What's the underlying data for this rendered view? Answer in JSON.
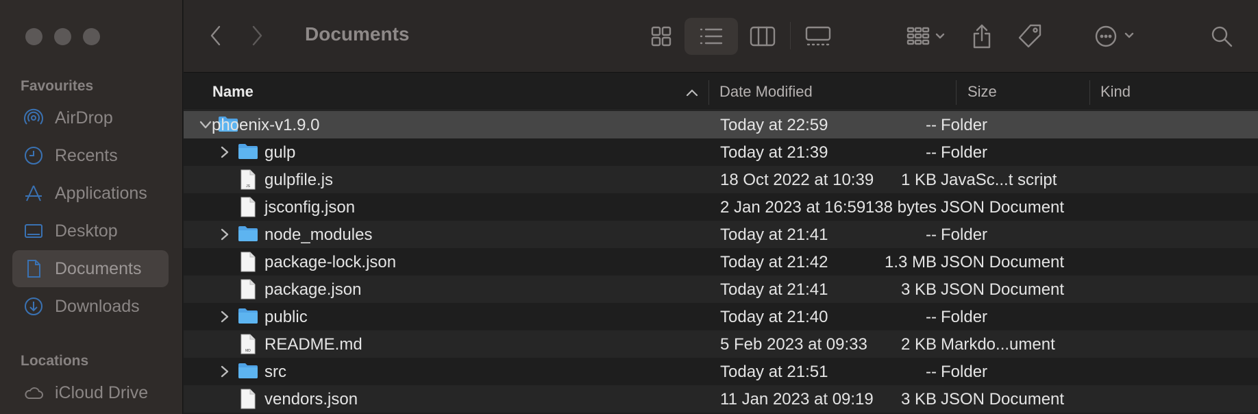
{
  "window": {
    "title": "Documents"
  },
  "sidebar": {
    "sections": [
      {
        "title": "Favourites",
        "items": [
          {
            "label": "AirDrop",
            "icon": "airdrop-icon"
          },
          {
            "label": "Recents",
            "icon": "clock-icon"
          },
          {
            "label": "Applications",
            "icon": "applications-icon"
          },
          {
            "label": "Desktop",
            "icon": "desktop-icon"
          },
          {
            "label": "Documents",
            "icon": "document-icon",
            "selected": true
          },
          {
            "label": "Downloads",
            "icon": "download-icon"
          }
        ]
      },
      {
        "title": "Locations",
        "items": [
          {
            "label": "iCloud Drive",
            "icon": "cloud-icon"
          }
        ]
      }
    ]
  },
  "toolbar": {
    "view_mode": "list",
    "buttons": [
      "back-icon",
      "forward-icon",
      "icon-view-icon",
      "list-view-icon",
      "column-view-icon",
      "gallery-view-icon",
      "group-icon",
      "share-icon",
      "tag-icon",
      "more-icon",
      "search-icon"
    ]
  },
  "columns": {
    "name": "Name",
    "date": "Date Modified",
    "size": "Size",
    "kind": "Kind"
  },
  "files": [
    {
      "name": "phoenix-v1.9.0",
      "date": "Today at 22:59",
      "size": "--",
      "kind": "Folder",
      "type": "folder",
      "expanded": true,
      "level": 0,
      "selected": true
    },
    {
      "name": "gulp",
      "date": "Today at 21:39",
      "size": "--",
      "kind": "Folder",
      "type": "folder",
      "level": 1
    },
    {
      "name": "gulpfile.js",
      "date": "18 Oct 2022 at 10:39",
      "size": "1 KB",
      "kind": "JavaSc...t script",
      "type": "file",
      "badge": "JS",
      "level": 1
    },
    {
      "name": "jsconfig.json",
      "date": "2 Jan 2023 at 16:59",
      "size": "138 bytes",
      "kind": "JSON Document",
      "type": "file",
      "level": 1
    },
    {
      "name": "node_modules",
      "date": "Today at 21:41",
      "size": "--",
      "kind": "Folder",
      "type": "folder",
      "level": 1
    },
    {
      "name": "package-lock.json",
      "date": "Today at 21:42",
      "size": "1.3 MB",
      "kind": "JSON Document",
      "type": "file",
      "level": 1
    },
    {
      "name": "package.json",
      "date": "Today at 21:41",
      "size": "3 KB",
      "kind": "JSON Document",
      "type": "file",
      "level": 1
    },
    {
      "name": "public",
      "date": "Today at 21:40",
      "size": "--",
      "kind": "Folder",
      "type": "folder",
      "level": 1
    },
    {
      "name": "README.md",
      "date": "5 Feb 2023 at 09:33",
      "size": "2 KB",
      "kind": "Markdo...ument",
      "type": "file",
      "badge": "MD",
      "level": 1
    },
    {
      "name": "src",
      "date": "Today at 21:51",
      "size": "--",
      "kind": "Folder",
      "type": "folder",
      "level": 1
    },
    {
      "name": "vendors.json",
      "date": "11 Jan 2023 at 09:19",
      "size": "3 KB",
      "kind": "JSON Document",
      "type": "file",
      "level": 1
    }
  ]
}
